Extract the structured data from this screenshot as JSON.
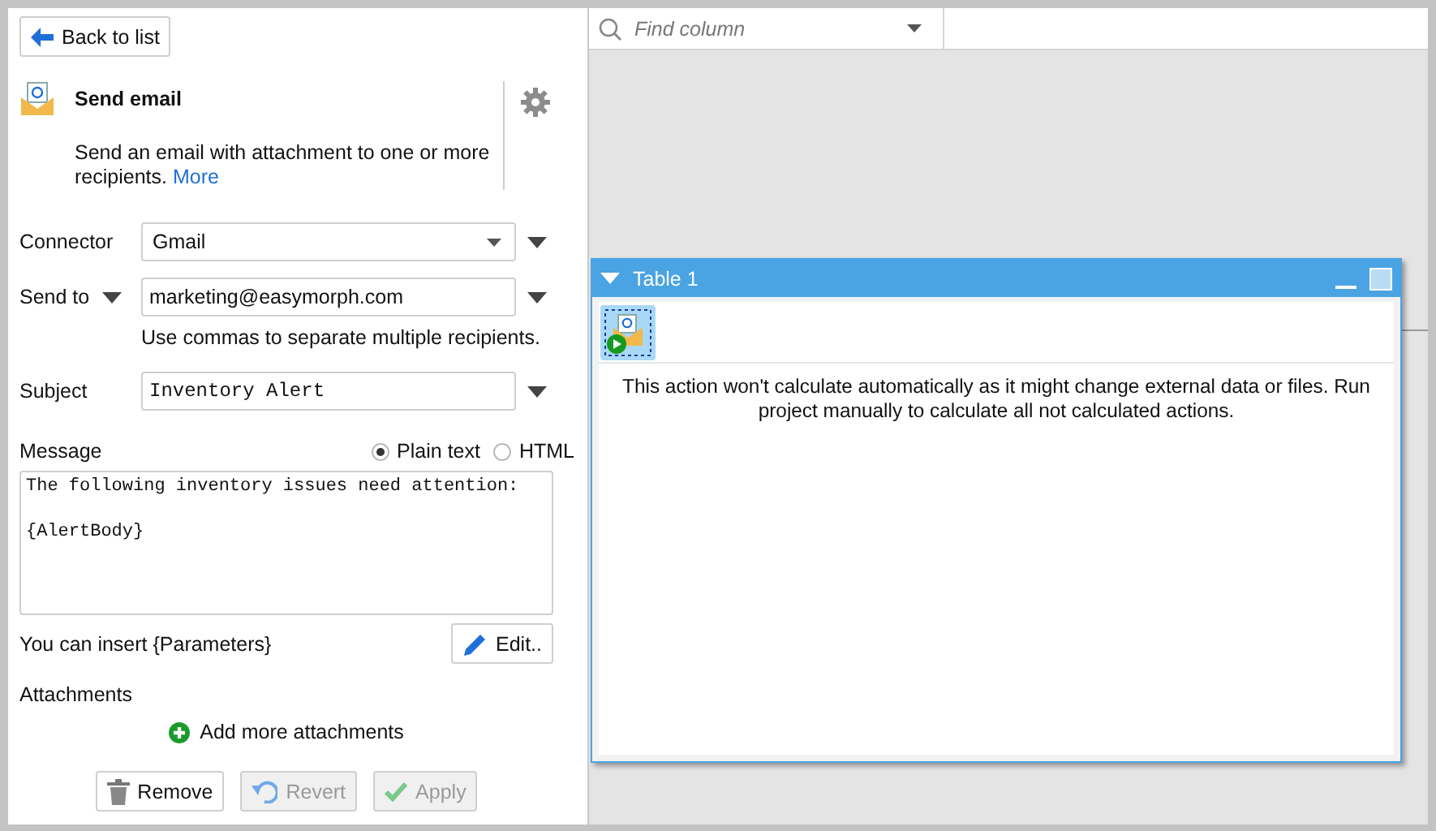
{
  "back_button": "Back to list",
  "action": {
    "title": "Send email",
    "description": "Send an email with attachment to one or more recipients.",
    "more_link": "More"
  },
  "connector": {
    "label": "Connector",
    "value": "Gmail"
  },
  "send_to": {
    "label": "Send to",
    "value": "marketing@easymorph.com",
    "hint": "Use commas to separate multiple recipients."
  },
  "subject": {
    "label": "Subject",
    "value": "Inventory Alert"
  },
  "message": {
    "label": "Message",
    "formats": [
      {
        "label": "Plain text",
        "selected": true
      },
      {
        "label": "HTML",
        "selected": false
      }
    ],
    "value": "The following inventory issues need attention:\n\n{AlertBody}"
  },
  "parameters_hint": "You can insert {Parameters}",
  "edit_button": "Edit..",
  "attachments": {
    "label": "Attachments",
    "add_button": "Add more attachments"
  },
  "footer_buttons": [
    {
      "kind": "remove",
      "label": "Remove",
      "disabled": false
    },
    {
      "kind": "revert",
      "label": "Revert",
      "disabled": true
    },
    {
      "kind": "apply",
      "label": "Apply",
      "disabled": true
    }
  ],
  "search": {
    "placeholder": "Find column"
  },
  "table_window": {
    "title": "Table 1",
    "notice": "This action won't calculate automatically as it might change external data or files. Run project manually to calculate all not calculated actions."
  }
}
